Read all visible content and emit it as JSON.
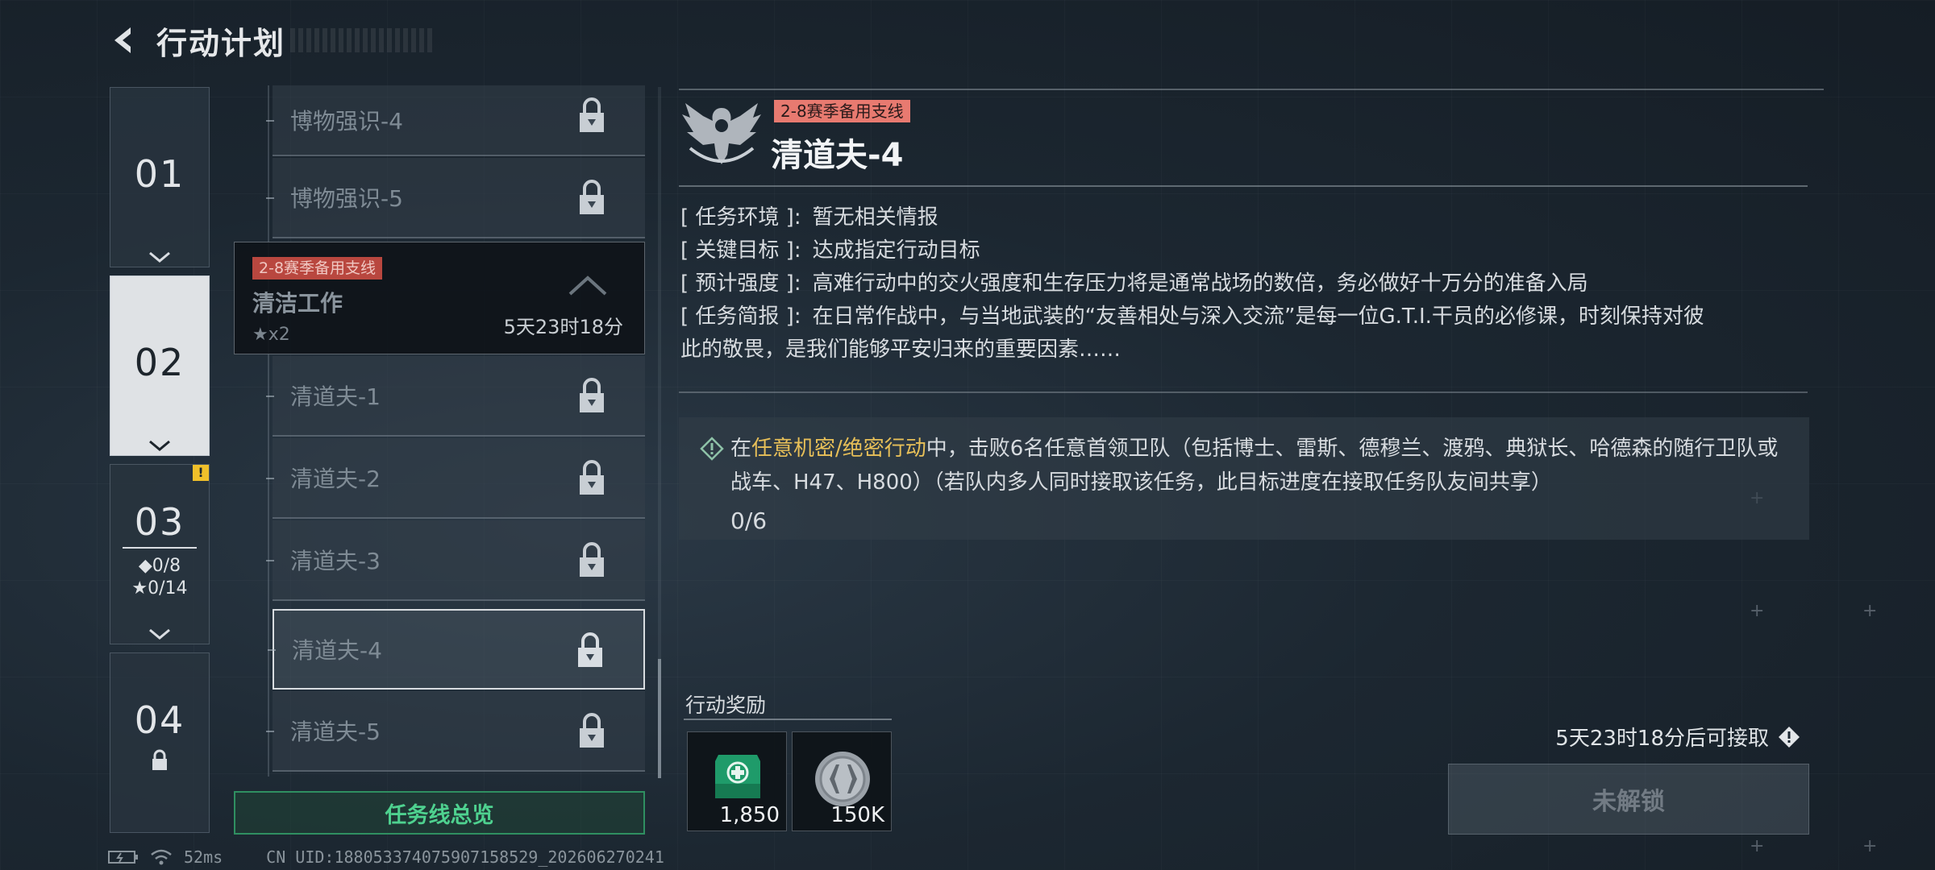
{
  "header": {
    "title": "行动计划"
  },
  "chapters": [
    {
      "num": "01"
    },
    {
      "num": "02"
    },
    {
      "num": "03",
      "diamonds": "◆0/8",
      "stars": "★0/14"
    },
    {
      "num": "04"
    }
  ],
  "mission_list": {
    "items_top": [
      "博物强识-4",
      "博物强识-5"
    ],
    "group": {
      "tag": "2-8赛季备用支线",
      "title": "清洁工作",
      "stars": "★x2",
      "time": "5天23时18分"
    },
    "items_bottom": [
      "清道夫-1",
      "清道夫-2",
      "清道夫-3",
      "清道夫-4",
      "清道夫-5"
    ]
  },
  "overview_button": "任务线总览",
  "detail": {
    "tag": "2-8赛季备用支线",
    "title": "清道夫-4",
    "info": [
      {
        "label": "[ 任务环境 ]:",
        "value": "暂无相关情报"
      },
      {
        "label": "[ 关键目标 ]:",
        "value": "达成指定行动目标"
      },
      {
        "label": "[ 预计强度 ]:",
        "value": "高难行动中的交火强度和生存压力将是通常战场的数倍，务必做好十万分的准备入局"
      },
      {
        "label": "[ 任务简报 ]:",
        "value": "在日常作战中，与当地武装的“友善相处与深入交流”是每一位G.T.I.干员的必修课，时刻保持对彼"
      }
    ],
    "info_cont": "此的敬畏，是我们能够平安归来的重要因素……",
    "objective": {
      "pre": "在",
      "highlight": "任意机密/绝密行动",
      "post": "中，击败6名任意首领卫队（包括博士、雷斯、德穆兰、渡鸦、典狱长、哈德森的随行卫队或战车、H47、H800）（若队内多人同时接取该任务，此目标进度在接取任务队友间共享）",
      "progress": "0/6"
    }
  },
  "rewards": {
    "label": "行动奖励",
    "items": [
      {
        "icon": "green-medkit-icon",
        "qty": "1,850"
      },
      {
        "icon": "silver-coin-icon",
        "qty": "150K"
      }
    ]
  },
  "unlock": {
    "time_text": "5天23时18分后可接取",
    "button": "未解锁"
  },
  "status_bar": {
    "ping": "52ms",
    "uid": "CN UID:1880533740759071585​29_202606270241"
  },
  "colors": {
    "accent_green": "#4ed18f",
    "highlight": "#e7bf58",
    "tag_red": "#e87a70"
  }
}
